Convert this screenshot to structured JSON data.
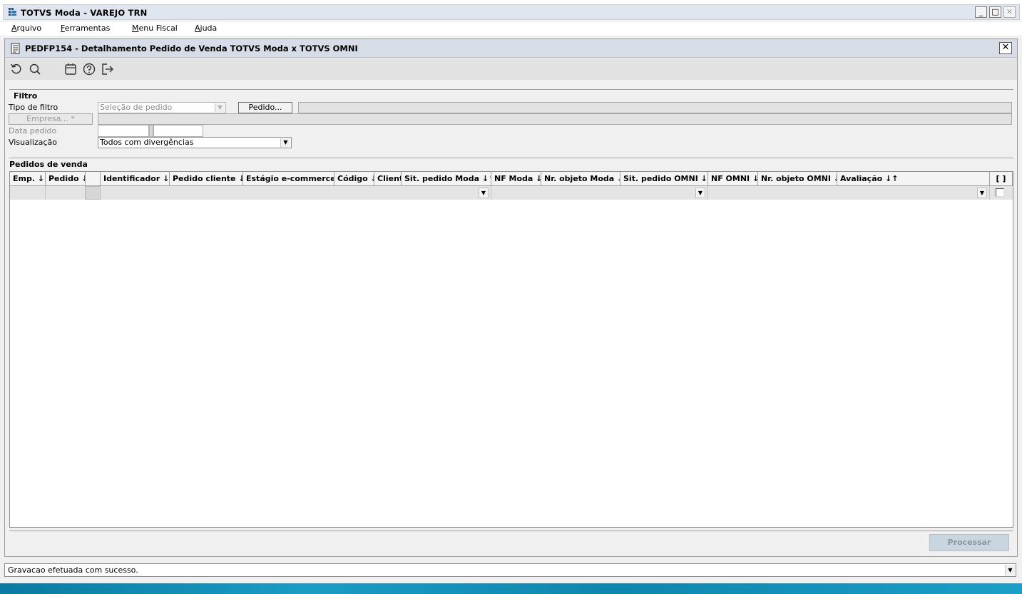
{
  "app": {
    "title": "TOTVS Moda - VAREJO TRN",
    "window_buttons": {
      "minimize": "_",
      "maximize": "□",
      "close": "✕"
    }
  },
  "menu": [
    {
      "label": "Arquivo",
      "accel": "A",
      "rest": "rquivo"
    },
    {
      "label": "Ferramentas",
      "accel": "F",
      "rest": "erramentas"
    },
    {
      "label": "Menu Fiscal",
      "accel": "M",
      "rest": "enu Fiscal"
    },
    {
      "label": "Ajuda",
      "accel": "A",
      "rest": "juda"
    }
  ],
  "form": {
    "title": "PEDFP154 - Detalhamento Pedido de Venda TOTVS Moda x TOTVS OMNI",
    "close": "✕",
    "toolbar": [
      "refresh-icon",
      "search-icon",
      "calendar-icon",
      "help-icon",
      "exit-icon"
    ]
  },
  "filter": {
    "section_title": "Filtro",
    "tipo_label": "Tipo de filtro",
    "tipo_value": "Seleção de pedido",
    "pedido_button": "Pedido...",
    "empresa_button": "Empresa... *",
    "data_label": "Data pedido",
    "visualizacao_label": "Visualização",
    "visualizacao_value": "Todos com divergências"
  },
  "grid": {
    "section_title": "Pedidos de venda",
    "columns": [
      "Emp. ↓↑",
      "Pedido ↓↑",
      "",
      "Identificador ↓↑",
      "Pedido cliente ↓↑",
      "Estágio e-commerce ↓↑",
      "Código ↓↑",
      "Cliente",
      "Sit. pedido Moda ↓↑",
      "NF Moda ↓↑",
      "Nr. objeto Moda ↓↑",
      "Sit. pedido OMNI ↓↑",
      "NF OMNI ↓↑",
      "Nr. objeto OMNI ↓↑",
      "Avaliação ↓↑",
      "[ ]"
    ],
    "rows": []
  },
  "actions": {
    "process": "Processar"
  },
  "status": {
    "message": "Gravacao efetuada com sucesso."
  },
  "colors": {
    "titlebar": "#dfe6ee",
    "form_titlebar": "#d6dde6",
    "desktop": "#1a9cc4"
  }
}
